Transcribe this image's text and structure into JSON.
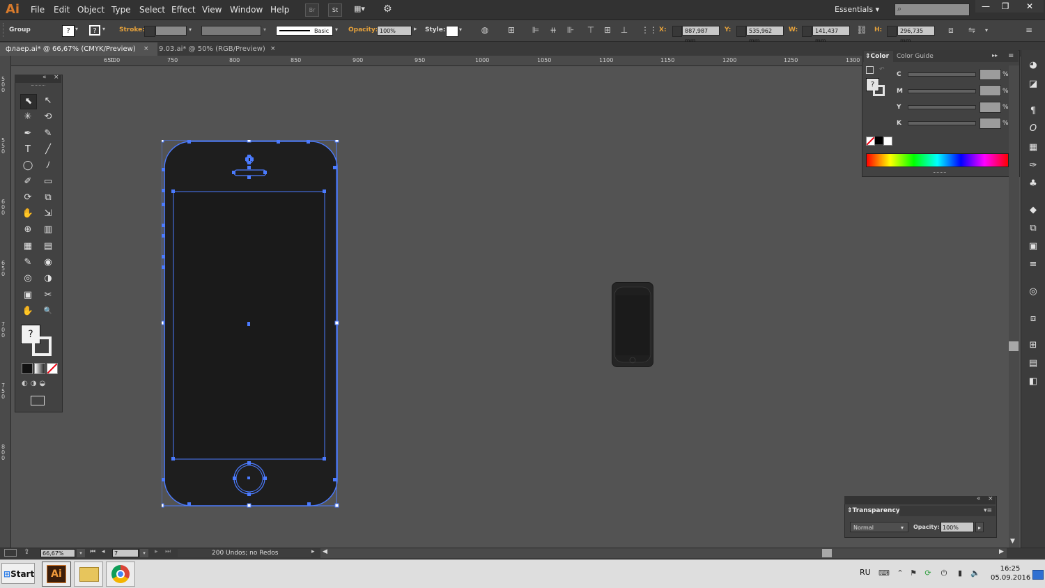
{
  "app": {
    "logo": "Ai",
    "workspace": "Essentials",
    "workspace_arrow": "▾"
  },
  "menu": [
    "File",
    "Edit",
    "Object",
    "Type",
    "Select",
    "Effect",
    "View",
    "Window",
    "Help"
  ],
  "menubar_buttons": [
    "Br",
    "St",
    "▦▾",
    "⚙"
  ],
  "window_controls": [
    "—",
    "❐",
    "✕"
  ],
  "control_bar": {
    "selection_label": "Group",
    "fill_swatch": "?",
    "stroke_swatch": "?",
    "stroke_label": "Stroke:",
    "brush_label": "Basic",
    "opacity_label": "Opacity:",
    "opacity_value": "100%",
    "style_label": "Style:",
    "x_label": "X:",
    "x_value": "887,987 mm",
    "y_label": "Y:",
    "y_value": "535,962 mm",
    "w_label": "W:",
    "w_value": "141,437 mm",
    "h_label": "H:",
    "h_value": "296,735 mm"
  },
  "doc_tabs": [
    {
      "label": "флаер.ai* @ 66,67% (CMYK/Preview)",
      "close": "×"
    },
    {
      "label": "9.03.ai* @ 50% (RGB/Preview)",
      "close": "×"
    }
  ],
  "ruler_h": [
    "650",
    "700",
    "750",
    "800",
    "850",
    "900",
    "950",
    "1000",
    "1050",
    "1100",
    "1150",
    "1200",
    "1250",
    "1300"
  ],
  "ruler_v": [
    "500",
    "550",
    "600",
    "650",
    "700",
    "750",
    "800"
  ],
  "tools": {
    "panel_collapse": "«",
    "panel_close": "×",
    "items": [
      "⬉",
      "↖",
      "✳",
      "⟲",
      "✒",
      "✎",
      "T",
      "╱",
      "◯",
      "ﾉ",
      "✐",
      "▭",
      "⟳",
      "⧉",
      "✋",
      "⇲",
      "⊕",
      "▥",
      "▦",
      "▤",
      "✎",
      "◉",
      "◎",
      "◑",
      "▣",
      "✂",
      "✋",
      "🔍"
    ],
    "fill_stroke": "?"
  },
  "color_panel": {
    "tab_color": "Color",
    "tab_guide": "Color Guide",
    "expand": "▸▸",
    "menu": "≡",
    "swatch": "?",
    "channels": [
      {
        "label": "C",
        "unit": "%"
      },
      {
        "label": "M",
        "unit": "%"
      },
      {
        "label": "Y",
        "unit": "%"
      },
      {
        "label": "K",
        "unit": "%"
      }
    ]
  },
  "transparency_panel": {
    "title": "Transparency",
    "mode": "Normal",
    "opacity_label": "Opacity:",
    "opacity_value": "100%"
  },
  "status_bar": {
    "zoom": "66,67%",
    "artboard": "7",
    "status": "200 Undos; no Redos"
  },
  "taskbar": {
    "start_label": "Start",
    "app_ai": "Ai",
    "language": "RU",
    "time": "16:25",
    "date": "05.09.2016"
  },
  "colors": {
    "accent_selection": "#4b7bff",
    "ai_brand": "#d97b2c",
    "canvas_bg": "#535353",
    "phone_body": "#1e1e1e"
  }
}
